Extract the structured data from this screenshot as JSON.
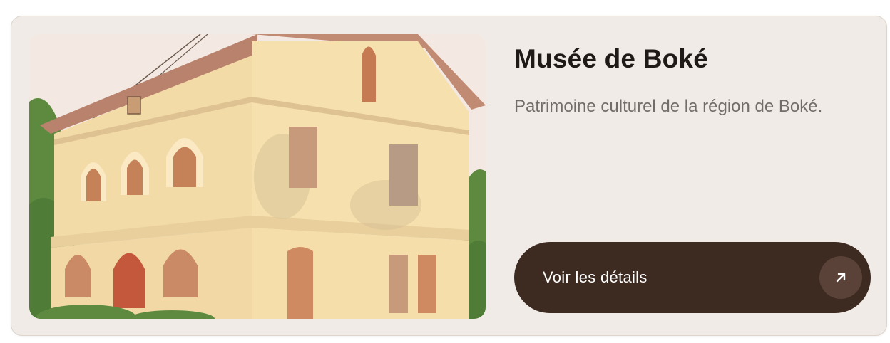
{
  "card": {
    "title": "Musée de Boké",
    "description": "Patrimoine culturel de la région de Boké.",
    "cta_label": "Voir les détails",
    "cta_icon": "arrow-up-right-icon",
    "image_subject": "two-storey colonial museum building"
  },
  "colors": {
    "card_bg": "#f0ebe6",
    "button_bg": "#3d2a21",
    "button_icon_bg": "#5a4238",
    "title": "#1f1a17",
    "description": "#736c68"
  }
}
